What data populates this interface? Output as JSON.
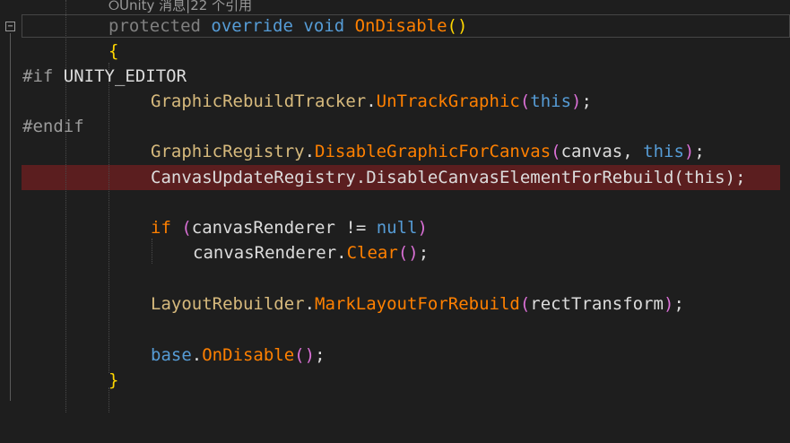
{
  "codelens": {
    "text": "⭘Unity 消息|22 个引用"
  },
  "lines": {
    "l1_protected": "protected",
    "l1_override": "override",
    "l1_void": "void",
    "l1_method": "OnDisable",
    "l1_parens": "()",
    "l2_brace": "{",
    "l3_if": "#if",
    "l3_sym": "UNITY_EDITOR",
    "l4_cls": "GraphicRebuildTracker",
    "l4_dot": ".",
    "l4_method": "UnTrackGraphic",
    "l4_open": "(",
    "l4_this": "this",
    "l4_close": ")",
    "l4_semi": ";",
    "l5_endif": "#endif",
    "l6_cls": "GraphicRegistry",
    "l6_dot": ".",
    "l6_method": "DisableGraphicForCanvas",
    "l6_open": "(",
    "l6_arg1": "canvas",
    "l6_comma": ", ",
    "l6_this": "this",
    "l6_close": ")",
    "l6_semi": ";",
    "l7_cls": "CanvasUpdateRegistry",
    "l7_dot": ".",
    "l7_method": "DisableCanvasElementForRebuild",
    "l7_open": "(",
    "l7_this": "this",
    "l7_close": ")",
    "l7_semi": ";",
    "l8_if": "if",
    "l8_open": " (",
    "l8_var": "canvasRenderer",
    "l8_op": " != ",
    "l8_null": "null",
    "l8_close": ")",
    "l9_var": "canvasRenderer",
    "l9_dot": ".",
    "l9_method": "Clear",
    "l9_parens": "()",
    "l9_semi": ";",
    "l10_cls": "LayoutRebuilder",
    "l10_dot": ".",
    "l10_method": "MarkLayoutForRebuild",
    "l10_open": "(",
    "l10_arg": "rectTransform",
    "l10_close": ")",
    "l10_semi": ";",
    "l11_base": "base",
    "l11_dot": ".",
    "l11_method": "OnDisable",
    "l11_parens": "()",
    "l11_semi": ";",
    "l12_brace": "}"
  },
  "gutter": {
    "fold_glyph": "−"
  },
  "colors": {
    "background": "#1e1e1e",
    "keyword": "#569cd6",
    "method": "#ff8000",
    "class": "#d7ba7d",
    "breakpoint_line": "#5b1e1f"
  }
}
